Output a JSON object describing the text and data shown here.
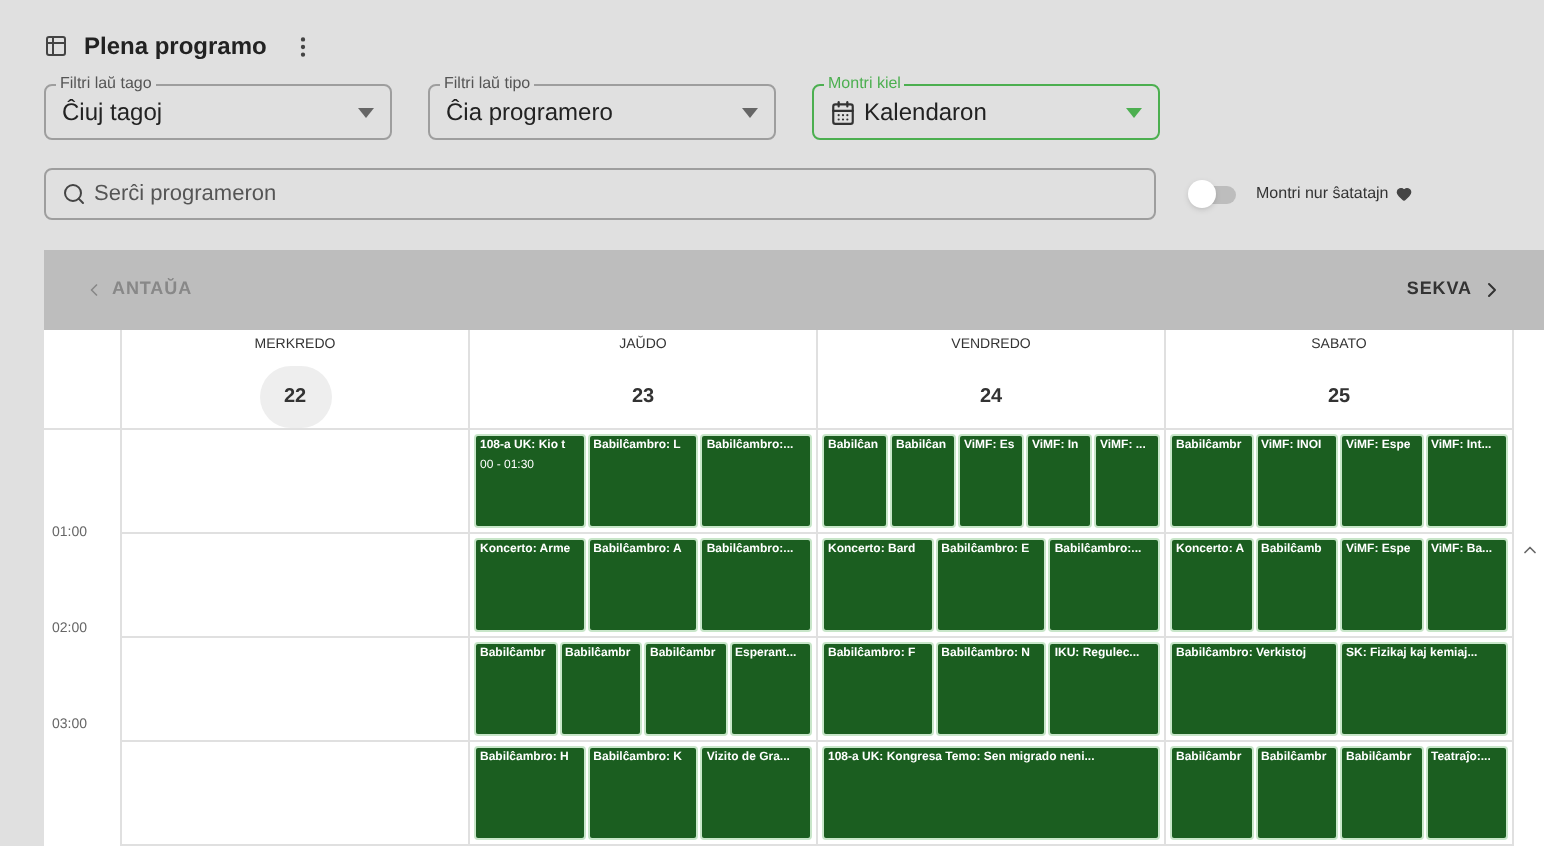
{
  "title": "Plena programo",
  "filters": [
    {
      "label": "Filtri laŭ tago",
      "value": "Ĉiuj tagoj",
      "active": false,
      "kind": "plain"
    },
    {
      "label": "Filtri laŭ tipo",
      "value": "Ĉia programero",
      "active": false,
      "kind": "plain"
    },
    {
      "label": "Montri kiel",
      "value": "Kalendaron",
      "active": true,
      "kind": "calendar"
    }
  ],
  "search": {
    "placeholder": "Serĉi programeron"
  },
  "favorites_toggle": {
    "label": "Montri nur ŝatatajn",
    "on": false
  },
  "nav": {
    "previous": "ANTAŬA",
    "next": "SEKVA"
  },
  "days": [
    {
      "name": "MERKREDO",
      "date": "22",
      "today": true
    },
    {
      "name": "JAŬDO",
      "date": "23",
      "today": false,
      "hours": [
        [
          {
            "title": "108-a UK: Kio t",
            "time": "00 - 01:30"
          },
          {
            "title": "Babilĉambro: L"
          },
          {
            "title": "Babilĉambro:..."
          }
        ],
        [
          {
            "title": "Koncerto: Arme"
          },
          {
            "title": "Babilĉambro: A"
          },
          {
            "title": "Babilĉambro:..."
          }
        ],
        [
          {
            "title": "Babilĉambr"
          },
          {
            "title": "Babilĉambr"
          },
          {
            "title": "Babilĉambr"
          },
          {
            "title": "Esperant..."
          }
        ],
        [
          {
            "title": "Babilĉambro: H"
          },
          {
            "title": "Babilĉambro: K"
          },
          {
            "title": "Vizito de Gra..."
          }
        ]
      ]
    },
    {
      "name": "VENDREDO",
      "date": "24",
      "today": false,
      "hours": [
        [
          {
            "title": "Babilĉan"
          },
          {
            "title": "Babilĉan"
          },
          {
            "title": "ViMF: Es"
          },
          {
            "title": "ViMF: In"
          },
          {
            "title": "ViMF: ..."
          }
        ],
        [
          {
            "title": "Koncerto: Bard"
          },
          {
            "title": "Babilĉambro: E"
          },
          {
            "title": "Babilĉambro:..."
          }
        ],
        [
          {
            "title": "Babilĉambro: F"
          },
          {
            "title": "Babilĉambro: N"
          },
          {
            "title": "IKU: Regulec..."
          }
        ],
        [
          {
            "title": "108-a UK: Kongresa Temo: Sen migrado neni..."
          }
        ]
      ]
    },
    {
      "name": "SABATO",
      "date": "25",
      "today": false,
      "hours": [
        [
          {
            "title": "Babilĉambr"
          },
          {
            "title": "ViMF: INOI"
          },
          {
            "title": "ViMF: Espe"
          },
          {
            "title": "ViMF: Int..."
          }
        ],
        [
          {
            "title": "Koncerto: A"
          },
          {
            "title": "Babilĉamb"
          },
          {
            "title": "ViMF: Espe"
          },
          {
            "title": "ViMF: Ba..."
          }
        ],
        [
          {
            "title": "Babilĉambro: Verkistoj"
          },
          {
            "title": "SK: Fizikaj kaj kemiaj..."
          }
        ],
        [
          {
            "title": "Babilĉambr"
          },
          {
            "title": "Babilĉambr"
          },
          {
            "title": "Babilĉambr"
          },
          {
            "title": "Teatraĵo:..."
          }
        ]
      ]
    }
  ],
  "hour_labels": [
    "01:00",
    "02:00",
    "03:00"
  ]
}
